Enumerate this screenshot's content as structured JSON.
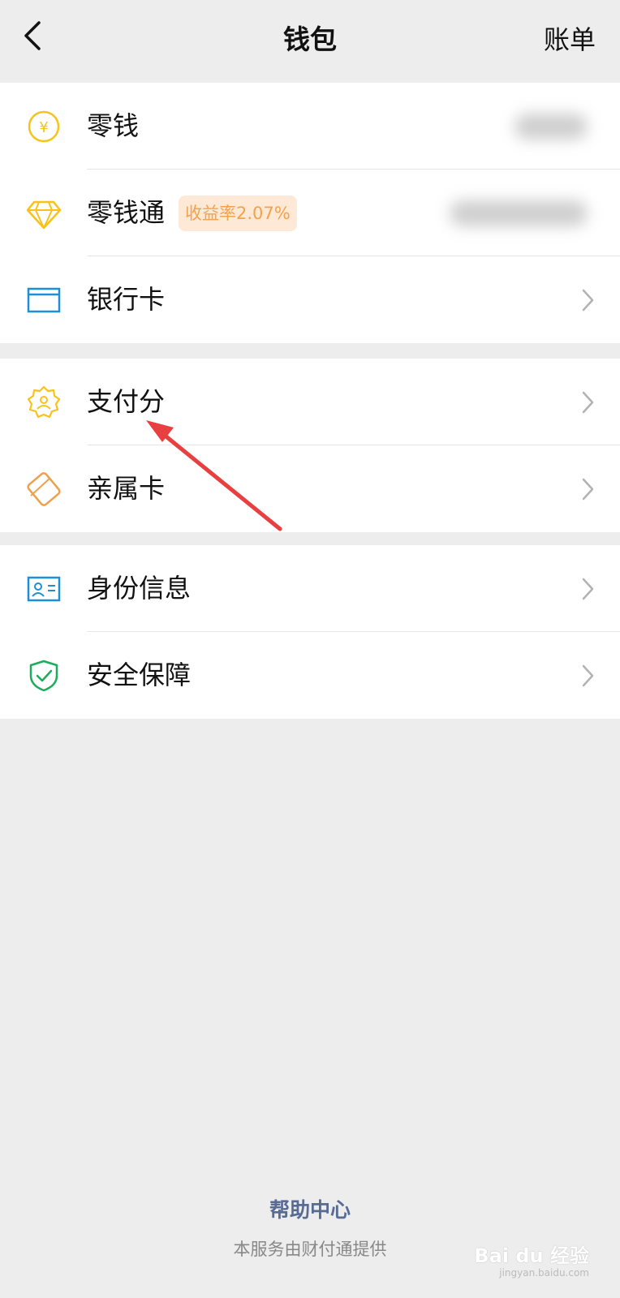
{
  "nav": {
    "title": "钱包",
    "right_label": "账单"
  },
  "wallet_group": {
    "items": [
      {
        "label": "零钱",
        "icon": "yuan-coin-icon"
      },
      {
        "label": "零钱通",
        "badge": "收益率2.07%",
        "icon": "diamond-icon"
      },
      {
        "label": "银行卡",
        "icon": "bank-card-icon"
      }
    ]
  },
  "credit_group": {
    "items": [
      {
        "label": "支付分",
        "icon": "payscore-badge-icon"
      },
      {
        "label": "亲属卡",
        "icon": "family-card-icon"
      }
    ]
  },
  "account_group": {
    "items": [
      {
        "label": "身份信息",
        "icon": "id-card-icon"
      },
      {
        "label": "安全保障",
        "icon": "shield-check-icon"
      }
    ]
  },
  "footer": {
    "help_center": "帮助中心",
    "provider": "本服务由财付通提供"
  },
  "watermark": {
    "text": "Bai du 经验",
    "sub": "jingyan.baidu.com"
  },
  "colors": {
    "background": "#ededed",
    "card": "#ffffff",
    "yellow_icon": "#f7c21a",
    "blue_icon": "#1d8ed8",
    "orange_icon": "#f0a04b",
    "green_icon": "#1aad5b",
    "badge_bg": "#fde9d6",
    "badge_text": "#f3a24c",
    "help_link": "#576b95",
    "annotation_arrow": "#e84040"
  }
}
